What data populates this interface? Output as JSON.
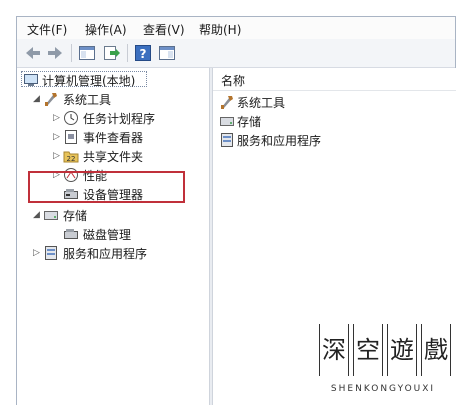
{
  "menubar": {
    "items": [
      "文件(F)",
      "操作(A)",
      "查看(V)",
      "帮助(H)"
    ]
  },
  "toolbar": {
    "buttons": [
      "back-arrow-icon",
      "forward-arrow-icon",
      "show-tree-icon",
      "export-list-icon",
      "help-icon",
      "properties-icon"
    ]
  },
  "tree": {
    "root": "计算机管理(本地)",
    "system_tools": "系统工具",
    "task_scheduler": "任务计划程序",
    "event_viewer": "事件查看器",
    "shared_folders": "共享文件夹",
    "performance": "性能",
    "device_manager": "设备管理器",
    "storage": "存储",
    "disk_management": "磁盘管理",
    "services_apps": "服务和应用程序"
  },
  "list": {
    "header": "名称",
    "items": [
      "系统工具",
      "存储",
      "服务和应用程序"
    ]
  },
  "watermark": {
    "chars": [
      "深",
      "空",
      "遊",
      "戲"
    ],
    "subtitle": "SHENKONGYOUXI"
  },
  "colors": {
    "highlight": "#c0303a",
    "accent": "#3b73c4"
  }
}
